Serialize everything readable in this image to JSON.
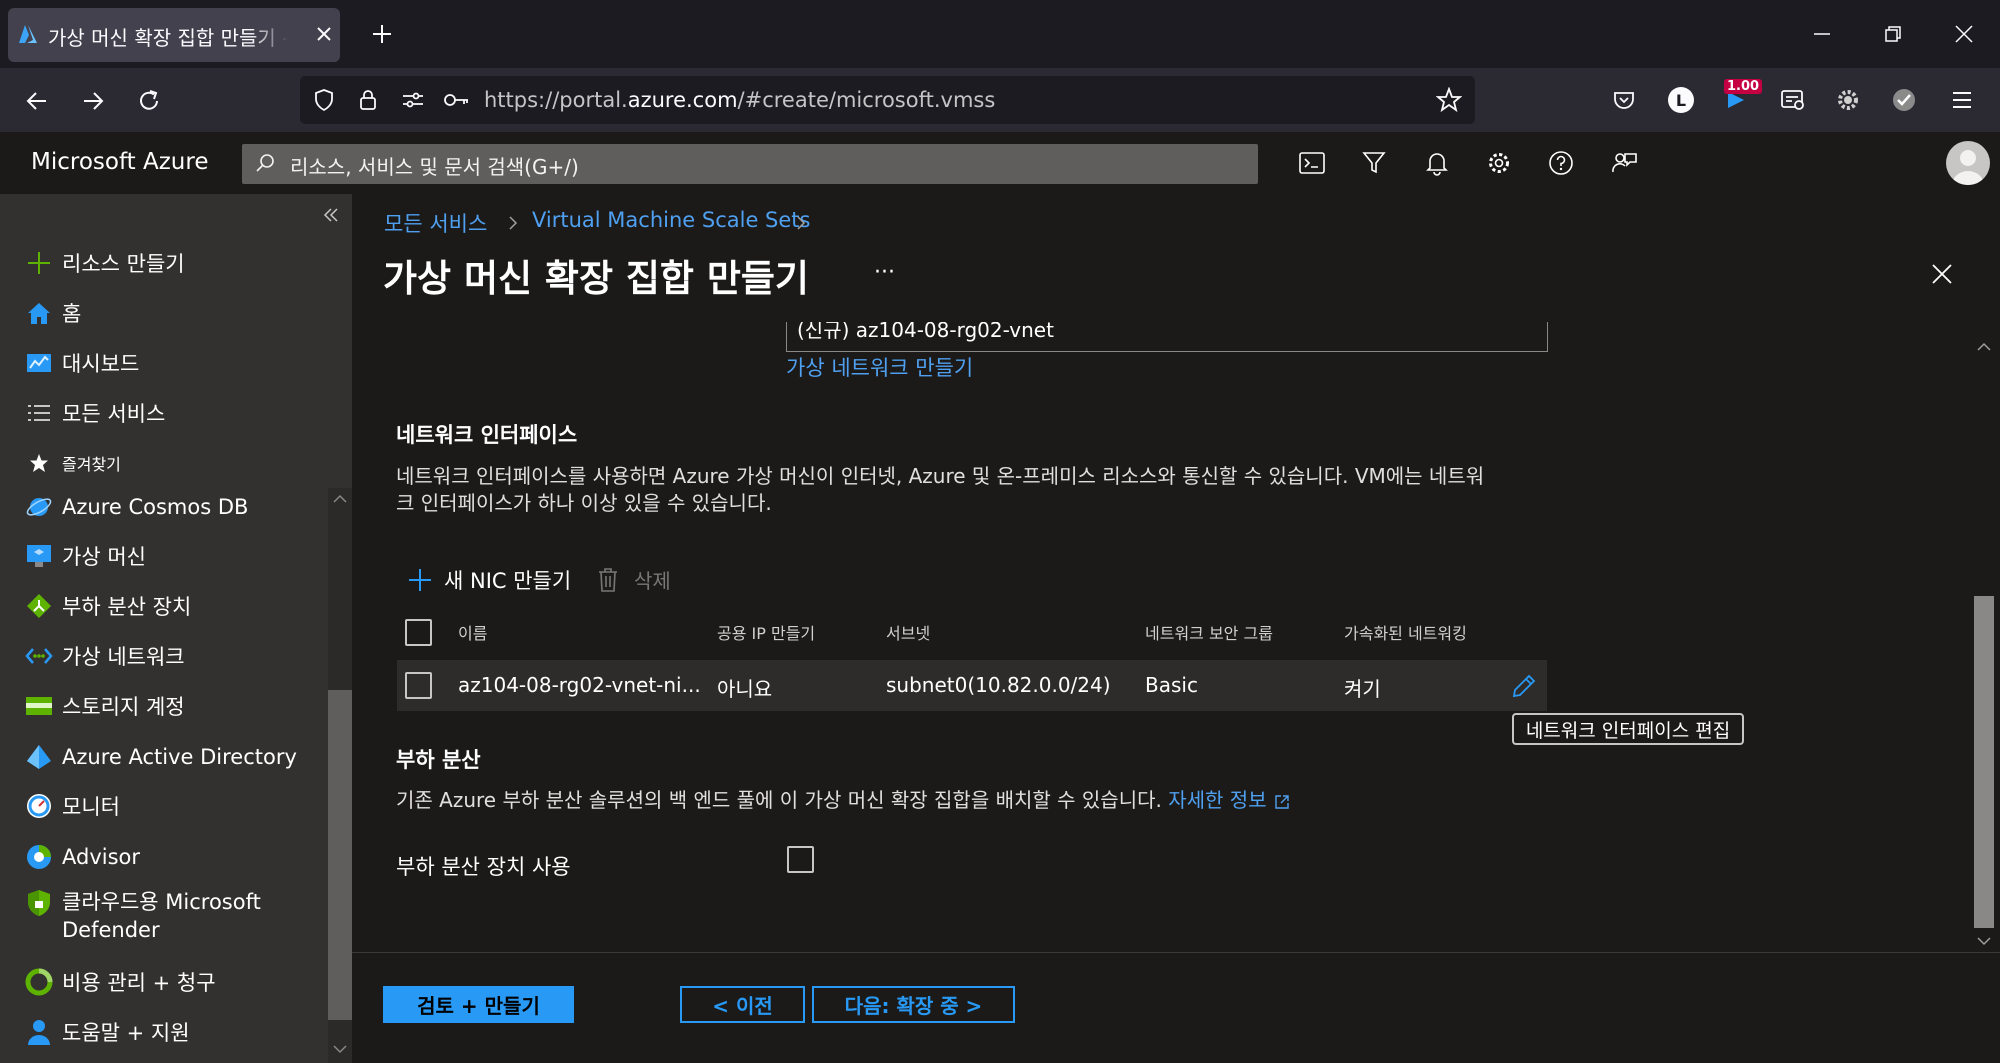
{
  "browser": {
    "tab_title": "가상 머신 확장 집합 만들기 - Microsoft Azure",
    "url_prefix": "https://portal.",
    "url_domain": "azure.com",
    "url_path": "/#create/microsoft.vmss",
    "download_badge": "1.00",
    "account_initial": "L"
  },
  "header": {
    "brand": "Microsoft Azure",
    "search_placeholder": "리소스, 서비스 및 문서 검색(G+/)"
  },
  "sidebar": {
    "items": [
      {
        "label": "리소스 만들기",
        "icon": "plus-icon"
      },
      {
        "label": "홈",
        "icon": "home-icon"
      },
      {
        "label": "대시보드",
        "icon": "dashboard-icon"
      },
      {
        "label": "모든 서비스",
        "icon": "list-icon"
      },
      {
        "label": "즐겨찾기",
        "icon": "star-icon"
      },
      {
        "label": "Azure Cosmos DB",
        "icon": "cosmos-db-icon"
      },
      {
        "label": "가상 머신",
        "icon": "virtual-machine-icon"
      },
      {
        "label": "부하 분산 장치",
        "icon": "load-balancer-icon"
      },
      {
        "label": "가상 네트워크",
        "icon": "virtual-network-icon"
      },
      {
        "label": "스토리지 계정",
        "icon": "storage-icon"
      },
      {
        "label": "Azure Active Directory",
        "icon": "active-directory-icon"
      },
      {
        "label": "모니터",
        "icon": "monitor-icon"
      },
      {
        "label": "Advisor",
        "icon": "advisor-icon"
      },
      {
        "label": "클라우드용 Microsoft",
        "label2": "Defender",
        "icon": "defender-icon"
      },
      {
        "label": "비용 관리 + 청구",
        "icon": "cost-icon"
      },
      {
        "label": "도움말 + 지원",
        "icon": "help-support-icon"
      }
    ]
  },
  "breadcrumb": {
    "items": [
      "모든 서비스",
      "Virtual Machine Scale Sets"
    ]
  },
  "page": {
    "title": "가상 머신 확장 집합 만들기",
    "more": "···"
  },
  "network": {
    "vnet_value": "(신규) az104-08-rg02-vnet",
    "create_vnet_link": "가상 네트워크 만들기"
  },
  "nic_section": {
    "title": "네트워크 인터페이스",
    "description_line1": "네트워크 인터페이스를 사용하면 Azure 가상 머신이 인터넷, Azure 및 온-프레미스 리소스와 통신할 수 있습니다. VM에는 네트워",
    "description_line2": "크 인터페이스가 하나 이상 있을 수 있습니다.",
    "create_nic": "새 NIC 만들기",
    "delete": "삭제",
    "columns": [
      "이름",
      "공용 IP 만들기",
      "서브넷",
      "네트워크 보안 그룹",
      "가속화된 네트워킹"
    ],
    "rows": [
      {
        "name": "az104-08-rg02-vnet-ni...",
        "public_ip": "아니요",
        "subnet": "subnet0(10.82.0.0/24)",
        "nsg": "Basic",
        "accelerated": "켜기"
      }
    ],
    "edit_tooltip": "네트워크 인터페이스 편집"
  },
  "lb_section": {
    "title": "부하 분산",
    "description": "기존 Azure 부하 분산 솔루션의 백 엔드 풀에 이 가상 머신 확장 집합을 배치할 수 있습니다.",
    "learn_more": "자세한 정보",
    "use_lb_label": "부하 분산 장치 사용"
  },
  "footer": {
    "review_create": "검토 + 만들기",
    "previous": "< 이전",
    "next": "다음: 확장 중 >"
  },
  "colors": {
    "accent": "#2899f5",
    "link": "#4fa0f0",
    "sidebar_bg": "#323130",
    "main_bg": "#1b1a19"
  }
}
